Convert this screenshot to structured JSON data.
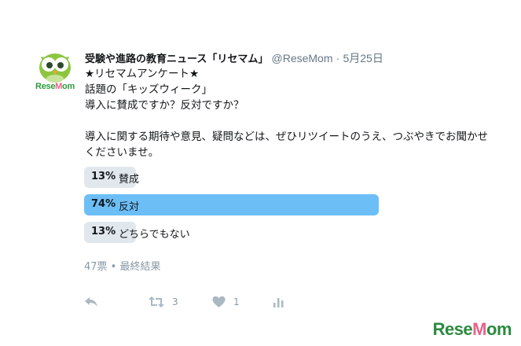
{
  "tweet": {
    "display_name": "受験や進路の教育ニュース「リセマム」",
    "handle": "@ReseMom",
    "separator": "·",
    "date": "5月25日",
    "lines": [
      "★リセマムアンケート★",
      "話題の「キッズウィーク」",
      "導入に賛成ですか？反対ですか？"
    ],
    "paragraph": "導入に関する期待や意見、疑問などは、ぜひリツイートのうえ、つぶやきでお聞かせくださいませ。"
  },
  "avatar": {
    "brand_text": "ReseMom"
  },
  "poll": {
    "options": [
      {
        "percent": "13%",
        "label": "賛成",
        "share": 0.13,
        "winner": false
      },
      {
        "percent": "74%",
        "label": "反対",
        "share": 0.74,
        "winner": true
      },
      {
        "percent": "13%",
        "label": "どちらでもない",
        "share": 0.13,
        "winner": false
      }
    ],
    "meta": "47票 • 最終結果"
  },
  "actions": {
    "reply": {
      "icon": "reply-icon"
    },
    "retweet": {
      "icon": "retweet-icon",
      "count": "3"
    },
    "like": {
      "icon": "heart-icon",
      "count": "1"
    },
    "analytics": {
      "icon": "analytics-icon"
    }
  },
  "watermark": "ReseMom",
  "colors": {
    "winner_bar": "#6cbef7",
    "bar": "#e1e8ed",
    "muted_text": "#8899a6",
    "brand_green": "#2b8a3e",
    "brand_pink": "#e9618a"
  }
}
